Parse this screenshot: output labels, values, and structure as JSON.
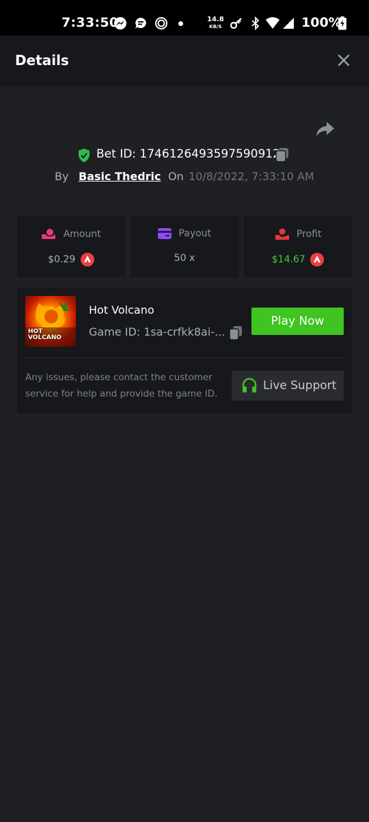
{
  "status_bar": {
    "time": "7:33:50",
    "net_speed_value": "14.8",
    "net_speed_unit": "KB/S",
    "battery": "100%",
    "icons": [
      "messenger-icon",
      "chat-bubble-icon",
      "sync-icon",
      "dot-icon",
      "key-icon",
      "bluetooth-icon",
      "wifi-icon",
      "signal-icon",
      "battery-charging-icon"
    ]
  },
  "header": {
    "title": "Details",
    "close_icon": "close-icon"
  },
  "bet": {
    "label": "Bet ID: 1746126493597590912",
    "by_label": "By",
    "user": "Basic Thedric",
    "on_label": "On",
    "date": "10/8/2022, 7:33:10 AM"
  },
  "stats": {
    "amount": {
      "label": "Amount",
      "value": "$0.29",
      "icon": "coins-hand-icon",
      "currency_icon": "avax-icon"
    },
    "payout": {
      "label": "Payout",
      "value": "50 x",
      "icon": "card-icon"
    },
    "profit": {
      "label": "Profit",
      "value": "$14.67",
      "icon": "money-hand-icon",
      "currency_icon": "avax-icon"
    }
  },
  "game": {
    "thumb_text_line1": "HOT",
    "thumb_text_line2": "VOLCANO",
    "title": "Hot Volcano",
    "id_text": "Game ID: 1sa-crfkk8ai-...",
    "play_label": "Play Now",
    "help_text": "Any issues, please contact the customer service for help and provide the game ID.",
    "support_label": "Live Support"
  },
  "colors": {
    "background": "#1f2023",
    "card": "#17181b",
    "accent_green": "#3fc421",
    "profit_green": "#3fcf3f",
    "shield_green": "#2ebd4a",
    "avax_red": "#e84142",
    "amount_pink": "#e43b7a",
    "payout_purple": "#8b4cf6",
    "profit_red": "#e23a3a"
  }
}
